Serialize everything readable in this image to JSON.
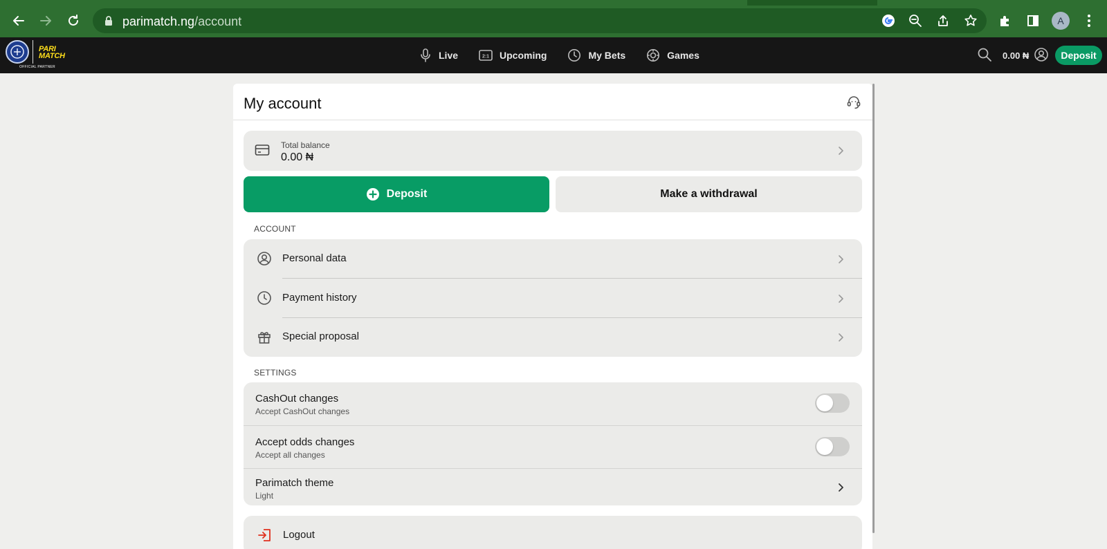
{
  "browser": {
    "url_domain": "parimatch.ng",
    "url_path": "/account",
    "profile_initial": "A",
    "icons": [
      "back-arrow-icon",
      "forward-arrow-icon",
      "reload-icon",
      "lock-icon",
      "google-icon",
      "zoom-out-icon",
      "share-icon",
      "star-icon",
      "extensions-icon",
      "side-panel-icon",
      "more-vert-icon"
    ]
  },
  "header": {
    "brand": "PARI MATCH",
    "partner_text": "OFFICIAL PARTNER",
    "nav": [
      {
        "label": "Live",
        "icon": "microphone-icon"
      },
      {
        "label": "Upcoming",
        "icon": "scoreboard-icon"
      },
      {
        "label": "My Bets",
        "icon": "clock-icon"
      },
      {
        "label": "Games",
        "icon": "casino-chip-icon"
      }
    ],
    "balance": "0.00 ₦",
    "deposit_label": "Deposit"
  },
  "account": {
    "title": "My account",
    "balance_label": "Total balance",
    "balance_value": "0.00 ₦",
    "deposit_button": "Deposit",
    "withdraw_button": "Make a withdrawal",
    "account_section": "ACCOUNT",
    "account_items": [
      {
        "label": "Personal data",
        "icon": "user-circle-icon"
      },
      {
        "label": "Payment history",
        "icon": "clock-icon"
      },
      {
        "label": "Special proposal",
        "icon": "gift-icon"
      }
    ],
    "settings_section": "SETTINGS",
    "settings": [
      {
        "title": "CashOut changes",
        "subtitle": "Accept CashOut changes",
        "toggle_on": false
      },
      {
        "title": "Accept odds changes",
        "subtitle": "Accept all changes",
        "toggle_on": false
      },
      {
        "title": "Parimatch theme",
        "subtitle": "Light"
      }
    ],
    "logout_label": "Logout"
  },
  "colors": {
    "accent_green": "#089c65",
    "browser_green": "#2e6f31",
    "header_bg": "#161616",
    "brand_yellow": "#ffdf1b",
    "logout_red": "#e0301e"
  }
}
